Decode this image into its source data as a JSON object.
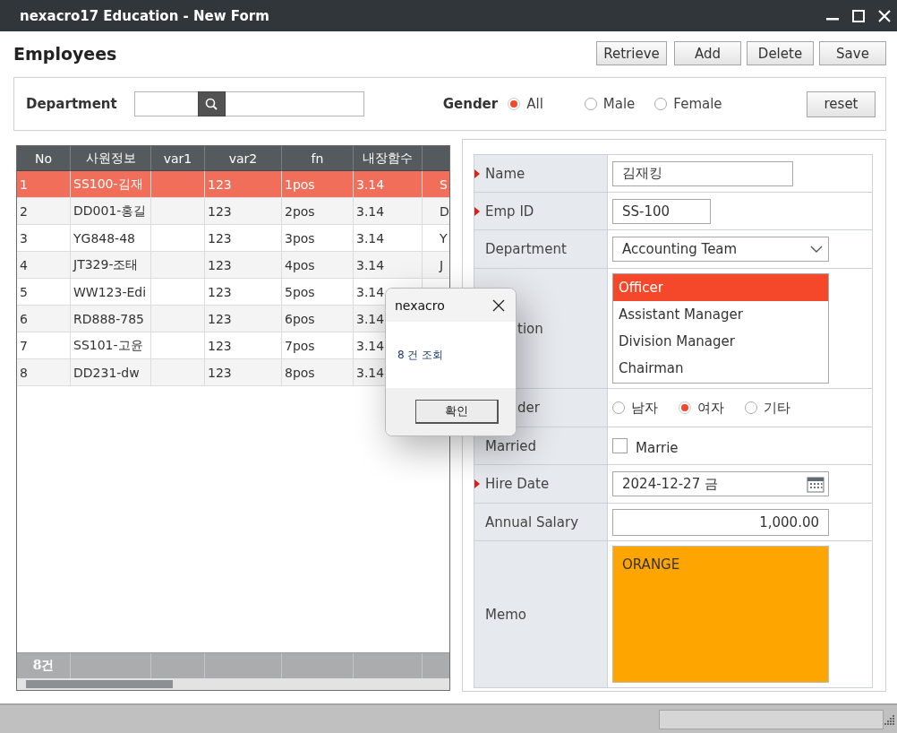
{
  "window": {
    "title": "nexacro17 Education - New Form"
  },
  "page_title": "Employees",
  "toolbar_buttons": [
    "Retrieve",
    "Add",
    "Delete",
    "Save"
  ],
  "search": {
    "department_label": "Department",
    "gender_label": "Gender",
    "gender_options": [
      {
        "label": "All",
        "selected": true
      },
      {
        "label": "Male",
        "selected": false
      },
      {
        "label": "Female",
        "selected": false
      }
    ],
    "reset_button": "reset"
  },
  "grid": {
    "columns": [
      "No",
      "사원정보",
      "var1",
      "var2",
      "fn",
      "내장함수"
    ],
    "rows": [
      {
        "selected": true,
        "cells": [
          "1",
          "SS100-김재",
          null,
          "123",
          "1pos",
          "3.14",
          "S"
        ]
      },
      {
        "selected": false,
        "cells": [
          "2",
          "DD001-홍길",
          null,
          "123",
          "2pos",
          "3.14",
          "D"
        ]
      },
      {
        "selected": false,
        "cells": [
          "3",
          "YG848-48",
          null,
          "123",
          "3pos",
          "3.14",
          "Y"
        ]
      },
      {
        "selected": false,
        "cells": [
          "4",
          "JT329-조태",
          null,
          "123",
          "4pos",
          "3.14",
          "J"
        ]
      },
      {
        "selected": false,
        "cells": [
          "5",
          "WW123-Edi",
          null,
          "123",
          "5pos",
          "3.14"
        ]
      },
      {
        "selected": false,
        "cells": [
          "6",
          "RD888-785",
          null,
          "123",
          "6pos",
          "3.14"
        ]
      },
      {
        "selected": false,
        "cells": [
          "7",
          "SS101-고윤",
          null,
          "123",
          "7pos",
          "3.14"
        ]
      },
      {
        "selected": false,
        "cells": [
          "8",
          "DD231-dw",
          null,
          "123",
          "8pos",
          "3.14"
        ]
      }
    ],
    "footer": "8건"
  },
  "form": {
    "rows": [
      {
        "kind": "text",
        "label": "Name",
        "required": true,
        "obscured": false,
        "value": "김재킹"
      },
      {
        "kind": "text",
        "label": "Emp ID",
        "required": true,
        "obscured": false,
        "value": "SS-100"
      },
      {
        "kind": "combo",
        "label": "Department",
        "required": false,
        "obscured": false,
        "value": "Accounting Team"
      },
      {
        "kind": "list",
        "label": "tion",
        "required": false,
        "obscured": true,
        "items": [
          {
            "label": "Officer",
            "selected": true
          },
          {
            "label": "Assistant Manager",
            "selected": false
          },
          {
            "label": "Division Manager",
            "selected": false
          },
          {
            "label": "Chairman",
            "selected": false
          }
        ]
      },
      {
        "kind": "radio",
        "label": "der",
        "required": false,
        "obscured": true,
        "options": [
          {
            "label": "남자",
            "selected": false
          },
          {
            "label": "여자",
            "selected": true
          },
          {
            "label": "기타",
            "selected": false
          }
        ]
      },
      {
        "kind": "checkbox",
        "label": "Married",
        "required": false,
        "obscured": false,
        "checked": false,
        "text": "Marrie"
      },
      {
        "kind": "date",
        "label": "Hire Date",
        "required": true,
        "obscured": false,
        "value": "2024-12-27 금"
      },
      {
        "kind": "number",
        "label": "Annual Salary",
        "required": false,
        "obscured": false,
        "value": "1,000.00"
      },
      {
        "kind": "memo",
        "label": "Memo",
        "required": false,
        "obscured": false,
        "value": "ORANGE"
      }
    ]
  },
  "dialog": {
    "title": "nexacro",
    "message": "8 건 조회",
    "button": "확인"
  }
}
